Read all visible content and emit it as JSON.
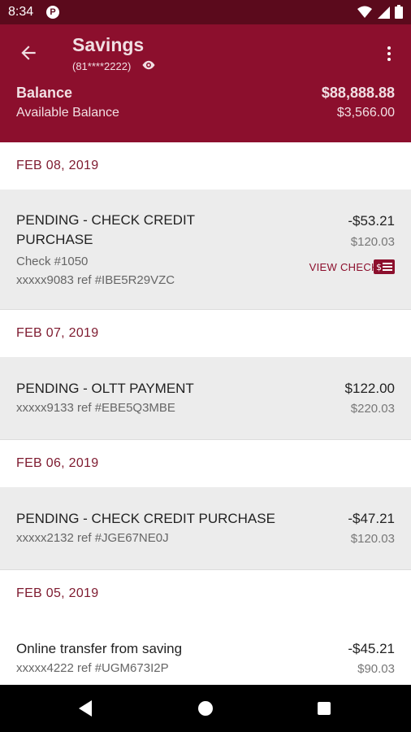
{
  "status_bar": {
    "time": "8:34",
    "badge": "P"
  },
  "header": {
    "title": "Savings",
    "account_masked": "(81****2222)",
    "balance_label": "Balance",
    "balance_value": "$88,888.88",
    "available_label": "Available Balance",
    "available_value": "$3,566.00"
  },
  "groups": [
    {
      "date": "FEB 08, 2019",
      "transactions": [
        {
          "name_line1": "PENDING - CHECK CREDIT",
          "name_line2": "PURCHASE",
          "check": "Check #1050",
          "ref": "xxxxx9083 ref #IBE5R29VZC",
          "amount": "-$53.21",
          "balance": "$120.03",
          "action": "VIEW CHECK"
        }
      ]
    },
    {
      "date": "FEB 07, 2019",
      "transactions": [
        {
          "name_line1": "PENDING - OLTT PAYMENT",
          "ref": "xxxxx9133 ref #EBE5Q3MBE",
          "amount": "$122.00",
          "balance": "$220.03"
        }
      ]
    },
    {
      "date": "FEB 06, 2019",
      "transactions": [
        {
          "name_line1": "PENDING - CHECK CREDIT PURCHASE",
          "ref": "xxxxx2132 ref #JGE67NE0J",
          "amount": "-$47.21",
          "balance": "$120.03"
        }
      ]
    },
    {
      "date": "FEB 05, 2019",
      "transactions": [
        {
          "name_line1": "Online transfer from saving",
          "ref": "xxxxx4222 ref #UGM673I2P",
          "amount": "-$45.21",
          "balance": "$90.03"
        }
      ]
    }
  ],
  "colors": {
    "brand": "#8c0f2d",
    "status_bar": "#5b0a1c",
    "date_text": "#7e1a2f"
  },
  "icons": [
    "back-arrow-icon",
    "eye-icon",
    "more-vert-icon",
    "check-icon",
    "wifi-icon",
    "signal-icon",
    "battery-icon"
  ]
}
